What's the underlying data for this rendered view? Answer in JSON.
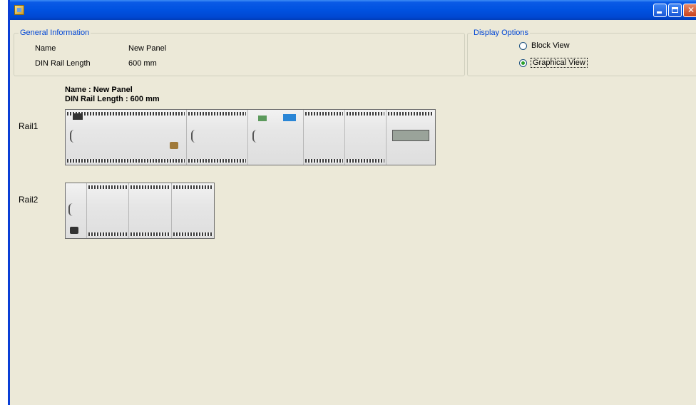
{
  "window": {
    "title": "",
    "controls": {
      "minimize": "minimize",
      "maximize": "maximize",
      "close": "close"
    }
  },
  "general_info": {
    "legend": "General Information",
    "name_label": "Name",
    "name_value": "New Panel",
    "din_label": "DIN Rail Length",
    "din_value": "600 mm"
  },
  "display_options": {
    "legend": "Display Options",
    "options": [
      {
        "label": "Block View",
        "checked": false
      },
      {
        "label": "Graphical View",
        "checked": true
      }
    ]
  },
  "caption": {
    "name_line": "Name : New Panel",
    "length_line": "DIN Rail Length : 600 mm"
  },
  "rails": [
    {
      "label": "Rail1"
    },
    {
      "label": "Rail2"
    }
  ]
}
